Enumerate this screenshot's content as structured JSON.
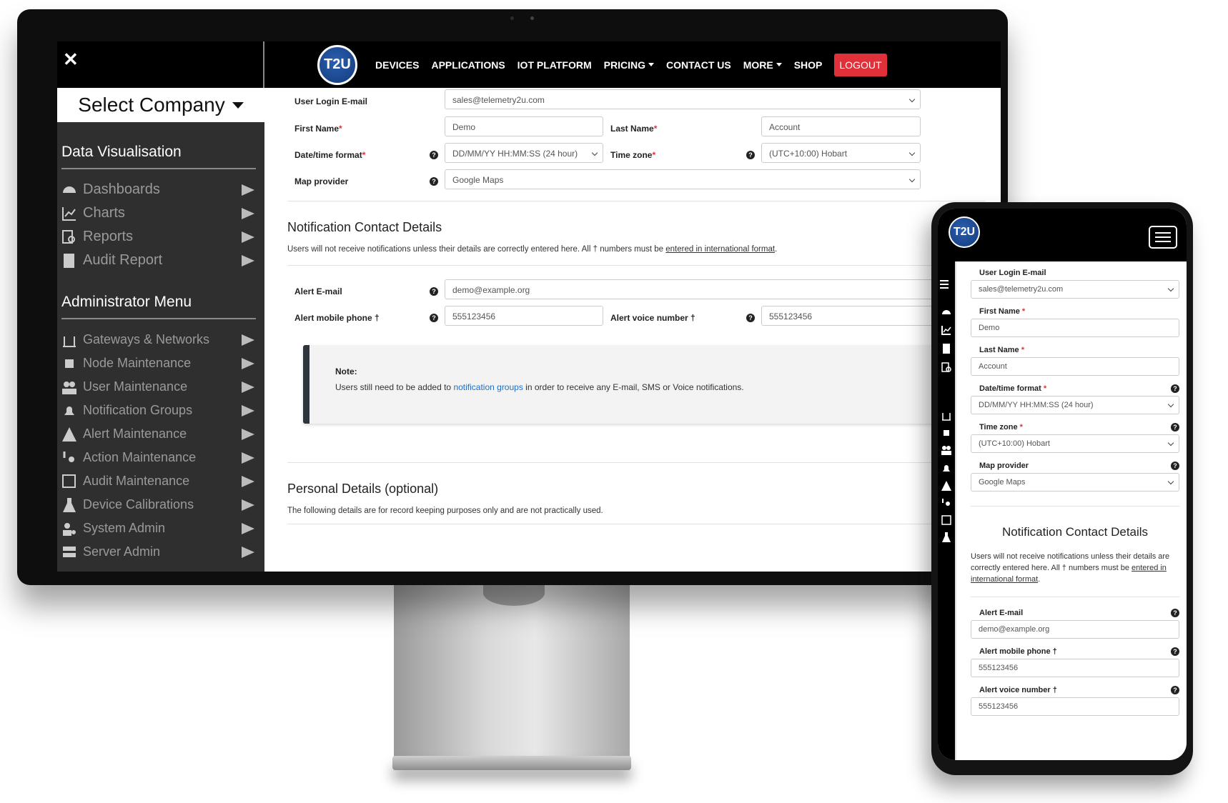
{
  "desktop": {
    "nav": {
      "logo_text": "T2U",
      "items": [
        {
          "label": "DEVICES",
          "dropdown": false
        },
        {
          "label": "APPLICATIONS",
          "dropdown": false
        },
        {
          "label": "IOT PLATFORM",
          "dropdown": false
        },
        {
          "label": "PRICING",
          "dropdown": true
        },
        {
          "label": "CONTACT US",
          "dropdown": false
        },
        {
          "label": "MORE",
          "dropdown": true
        },
        {
          "label": "SHOP",
          "dropdown": false
        }
      ],
      "logout_label": "LOGOUT"
    },
    "sidebar": {
      "close_symbol": "✕",
      "company_label": "Select Company",
      "data_vis_heading": "Data Visualisation",
      "data_vis_items": [
        {
          "label": "Dashboards",
          "icon": "gauge-icon"
        },
        {
          "label": "Charts",
          "icon": "chart-icon"
        },
        {
          "label": "Reports",
          "icon": "report-icon"
        },
        {
          "label": "Audit Report",
          "icon": "audit-report-icon"
        }
      ],
      "admin_heading": "Administrator Menu",
      "admin_items": [
        {
          "label": "Gateways & Networks",
          "icon": "gateway-icon"
        },
        {
          "label": "Node Maintenance",
          "icon": "chip-icon"
        },
        {
          "label": "User Maintenance",
          "icon": "users-icon"
        },
        {
          "label": "Notification Groups",
          "icon": "bell-icon"
        },
        {
          "label": "Alert Maintenance",
          "icon": "warning-icon"
        },
        {
          "label": "Action Maintenance",
          "icon": "action-icon"
        },
        {
          "label": "Audit Maintenance",
          "icon": "audit-icon"
        },
        {
          "label": "Device Calibrations",
          "icon": "flask-icon"
        },
        {
          "label": "System Admin",
          "icon": "user-gear-icon"
        },
        {
          "label": "Server Admin",
          "icon": "server-icon"
        }
      ]
    },
    "form": {
      "login_email_label": "User Login E-mail",
      "login_email_value": "sales@telemetry2u.com",
      "first_name_label": "First Name",
      "first_name_value": "Demo",
      "last_name_label": "Last Name",
      "last_name_value": "Account",
      "datetime_label": "Date/time format",
      "datetime_value": "DD/MM/YY HH:MM:SS (24 hour)",
      "timezone_label": "Time zone",
      "timezone_value": "(UTC+10:00) Hobart",
      "map_label": "Map provider",
      "map_value": "Google Maps"
    },
    "notification": {
      "title": "Notification Contact Details",
      "desc_prefix": "Users will not receive notifications unless their details are correctly entered here. All † numbers must be ",
      "desc_link": "entered in international format",
      "desc_suffix": ".",
      "alert_email_label": "Alert E-mail",
      "alert_email_value": "demo@example.org",
      "alert_mobile_label": "Alert mobile phone †",
      "alert_mobile_value": "555123456",
      "alert_voice_label": "Alert voice number †",
      "alert_voice_value": "555123456",
      "note_title": "Note:",
      "note_prefix": "Users still need to be added to ",
      "note_link": "notification groups",
      "note_suffix": " in order to receive any E-mail, SMS or Voice notifications."
    },
    "personal": {
      "title": "Personal Details (optional)",
      "desc": "The following details are for record keeping purposes only and are not practically used."
    }
  },
  "mobile": {
    "logo_text": "T2U",
    "login_email_label": "User Login E-mail",
    "login_email_value": "sales@telemetry2u.com",
    "first_name_label": "First Name",
    "first_name_value": "Demo",
    "last_name_label": "Last Name",
    "last_name_value": "Account",
    "datetime_label": "Date/time format",
    "datetime_value": "DD/MM/YY HH:MM:SS (24 hour)",
    "timezone_label": "Time zone",
    "timezone_value": "(UTC+10:00) Hobart",
    "map_label": "Map provider",
    "map_value": "Google Maps",
    "notif_title": "Notification Contact Details",
    "notif_desc_prefix": "Users will not receive notifications unless their details are correctly entered here. All † numbers must be ",
    "notif_desc_link": "entered in international format",
    "notif_desc_suffix": ".",
    "alert_email_label": "Alert E-mail",
    "alert_email_value": "demo@example.org",
    "alert_mobile_label": "Alert mobile phone †",
    "alert_mobile_value": "555123456",
    "alert_voice_label": "Alert voice number †",
    "alert_voice_value": "555123456"
  },
  "colors": {
    "nav_bg": "#000000",
    "sidebar_bg": "#2f2f2f",
    "logout_bg": "#e0303a",
    "required": "#e0303a",
    "link": "#1f6fc4",
    "logo_blue": "#1f4f9c"
  }
}
